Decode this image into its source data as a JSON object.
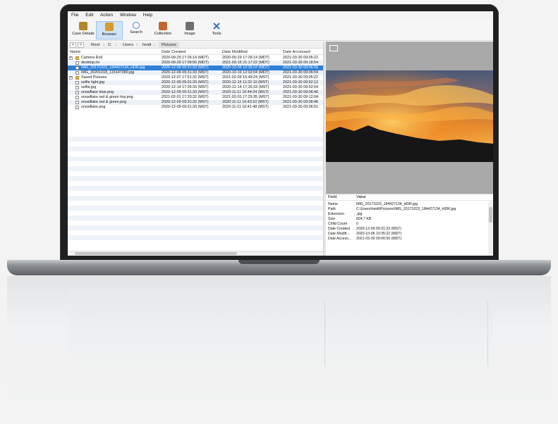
{
  "menu": [
    "File",
    "Edit",
    "Action",
    "Window",
    "Help"
  ],
  "toolbar": [
    {
      "label": "Case Details",
      "icon": "case-icon",
      "color": "#b3862e",
      "active": false
    },
    {
      "label": "Browser",
      "icon": "folder-icon",
      "color": "#d99a2b",
      "active": true
    },
    {
      "label": "Search",
      "icon": "search-icon",
      "color": "#5a84c8",
      "active": false
    },
    {
      "label": "Collection",
      "icon": "collection-icon",
      "color": "#c0672e",
      "active": false
    },
    {
      "label": "Image",
      "icon": "image-icon",
      "color": "#6f6f6f",
      "active": false
    },
    {
      "label": "Tools",
      "icon": "tools-icon",
      "color": "#3c6fb2",
      "active": false
    }
  ],
  "nav": {
    "back": "<",
    "forward": ">"
  },
  "breadcrumb": [
    "Root",
    "C:",
    "Users",
    "heidi",
    "Pictures"
  ],
  "columns": [
    "Name",
    "Date Created",
    "Date Modified",
    "Date Accessed"
  ],
  "rows": [
    {
      "name": "Camera Roll",
      "created": "2020-09-29 17:26:14 (MDT)",
      "modified": "2020-09-29 17:26:14 (MDT)",
      "accessed": "2021-03-30 09:05:22",
      "type": "folder",
      "expandable": true,
      "selected": false
    },
    {
      "name": "desktop.ini",
      "created": "2020-09-29 17:09:50 (MDT)",
      "modified": "2021-03-15 21:17:22 (MDT)",
      "accessed": "2021-03-30 09:18:54",
      "type": "file",
      "expandable": false,
      "selected": false
    },
    {
      "name": "IMG_20171023_184427134_HDR.jpg",
      "created": "2020-12-09 09:31:33 (MST)",
      "modified": "2020-10-06 10:35:22 (MDT)",
      "accessed": "2021-03-30 09:06:56",
      "type": "file",
      "expandable": false,
      "selected": true
    },
    {
      "name": "IMG_20201018_115147380.jpg",
      "created": "2020-12-09 09:31:33 (MST)",
      "modified": "2020-10-19 12:02:04 (MDT)",
      "accessed": "2021-03-30 09:06:54",
      "type": "file",
      "expandable": false,
      "selected": false
    },
    {
      "name": "Saved Pictures",
      "created": "2020-12-07 17:51:32 (MST)",
      "modified": "2021-02-09 15:49:24 (MST)",
      "accessed": "2021-03-30 09:05:22",
      "type": "folder",
      "expandable": true,
      "selected": false
    },
    {
      "name": "selfie tight.jpg",
      "created": "2020-12-09 09:31:33 (MST)",
      "modified": "2020-12-15 11:32:10 (MST)",
      "accessed": "2021-03-30 09:52:12",
      "type": "file",
      "expandable": false,
      "selected": false
    },
    {
      "name": "selfie.jpg",
      "created": "2020-12-14 17:26:33 (MST)",
      "modified": "2020-12-14 17:26:33 (MST)",
      "accessed": "2021-03-30 09:52:04",
      "type": "file",
      "expandable": false,
      "selected": false
    },
    {
      "name": "snowflake blue.png",
      "created": "2020-12-09 09:31:33 (MST)",
      "modified": "2020-11-11 16:44:34 (MST)",
      "accessed": "2021-03-30 09:06:46",
      "type": "file",
      "expandable": false,
      "selected": false
    },
    {
      "name": "snowflake red & green tiny.png",
      "created": "2021-02-01 17:20:32 (MST)",
      "modified": "2021-02-01 17:25:35 (MST)",
      "accessed": "2021-03-30 09:12:04",
      "type": "file",
      "expandable": false,
      "selected": false
    },
    {
      "name": "snowflake red & green.png",
      "created": "2020-12-09 09:31:33 (MST)",
      "modified": "2020-11-11 16:43:10 (MST)",
      "accessed": "2021-03-30 09:06:46",
      "type": "file",
      "expandable": false,
      "selected": false
    },
    {
      "name": "snowflake.png",
      "created": "2020-12-09 09:31:33 (MST)",
      "modified": "2020-11-11 16:41:48 (MST)",
      "accessed": "2021-03-30 09:06:51",
      "type": "file",
      "expandable": false,
      "selected": false
    }
  ],
  "properties": {
    "headers": [
      "Field",
      "Value"
    ],
    "rows": [
      {
        "field": "Name",
        "value": "IMG_20171023_184427134_HDR.jpg"
      },
      {
        "field": "Path",
        "value": "C:\\Users\\heidi\\Pictures\\IMG_20171023_184427134_HDR.jpg"
      },
      {
        "field": "Extension",
        "value": ".jpg"
      },
      {
        "field": "Size",
        "value": "824.7 KB"
      },
      {
        "field": "Child Count",
        "value": "0"
      },
      {
        "field": "Date Created",
        "value": "2020-12-09 09:31:33 (MST)"
      },
      {
        "field": "Date Modifi...",
        "value": "2020-10-06 10:35:22 (MDT)"
      },
      {
        "field": "Date Access...",
        "value": "2021-03-30 09:06:56 (MDT)"
      }
    ]
  },
  "colors": {
    "selection": "#2f7fd6",
    "row_alt": "#edf2f8",
    "sky_top": "#4a5a78",
    "sunset": "#f08a24"
  }
}
